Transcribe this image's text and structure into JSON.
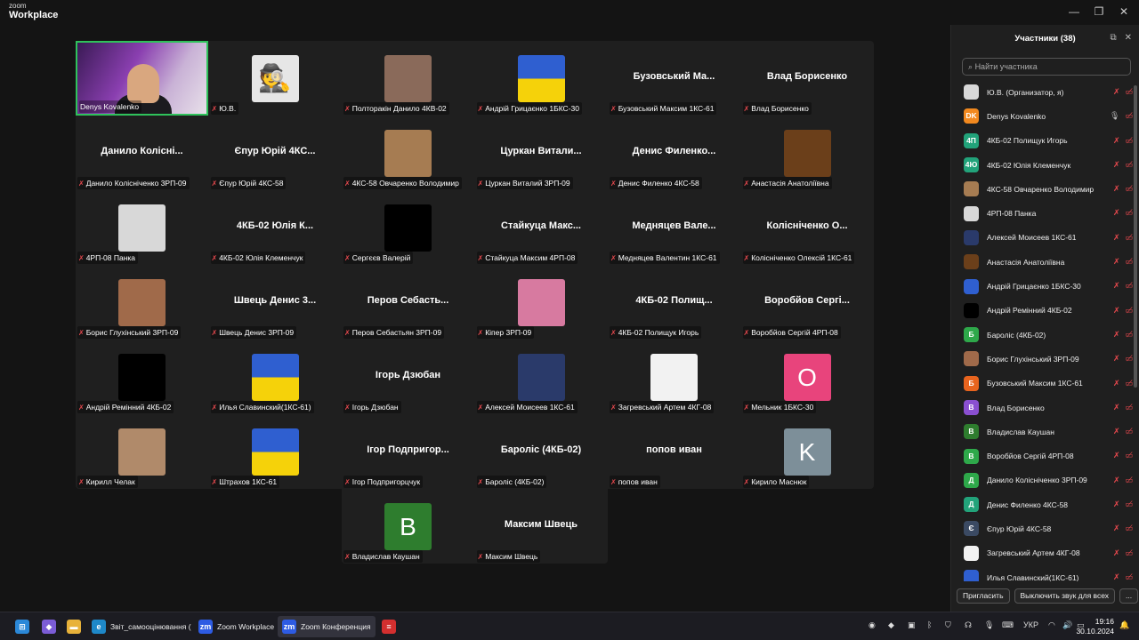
{
  "app": {
    "logo_line1": "zoom",
    "logo_line2": "Workplace"
  },
  "tiles": [
    {
      "caption": "Denys Kovalenko",
      "big": "",
      "avatar": "video",
      "active": true,
      "muted": false
    },
    {
      "caption": "Ю.В.",
      "big": "",
      "avatar": "spy",
      "color": "#e6e6e6"
    },
    {
      "caption": "Полторакін Данило 4КВ-02",
      "big": "",
      "avatar": "photo",
      "color": "#8a6a5a"
    },
    {
      "caption": "Андрій Грицаєнко 1БКС-30",
      "big": "",
      "avatar": "flag",
      "color": "#2f5fd0"
    },
    {
      "caption": "Бузовський Максим 1КС-61",
      "big": "Бузовський Ма...",
      "avatar": ""
    },
    {
      "caption": "Влад Борисенко",
      "big": "Влад Борисенко",
      "avatar": ""
    },
    {
      "caption": "Данило Колісніченко 3РП-09",
      "big": "Данило Колісні...",
      "avatar": ""
    },
    {
      "caption": "Єпур Юрій 4КС-58",
      "big": "Єпур Юрій 4КС...",
      "avatar": ""
    },
    {
      "caption": "4КС-58 Овчаренко Володимир",
      "big": "",
      "avatar": "photo",
      "color": "#a67c52"
    },
    {
      "caption": "Цуркан Виталий 3РП-09",
      "big": "Цуркан Витали...",
      "avatar": ""
    },
    {
      "caption": "Денис Филенко 4КС-58",
      "big": "Денис Филенко...",
      "avatar": ""
    },
    {
      "caption": "Анастасія Анатоліївна",
      "big": "",
      "avatar": "photo",
      "color": "#6b3f1a"
    },
    {
      "caption": "4РП-08 Панка",
      "big": "",
      "avatar": "photo",
      "color": "#d8d8d8"
    },
    {
      "caption": "4КБ-02 Юлія Клеменчук",
      "big": "4КБ-02 Юлія К...",
      "avatar": ""
    },
    {
      "caption": "Сергєєв Валерій",
      "big": "",
      "avatar": "black",
      "color": "#000000"
    },
    {
      "caption": "Стайкуца Максим 4РП-08",
      "big": "Стайкуца Макс...",
      "avatar": ""
    },
    {
      "caption": "Медняцев Валентин 1КС-61",
      "big": "Медняцев Вале...",
      "avatar": ""
    },
    {
      "caption": "Колісніченко Олексій 1КС-61",
      "big": "Колісніченко О...",
      "avatar": ""
    },
    {
      "caption": "Борис Глухінський 3РП-09",
      "big": "",
      "avatar": "photo",
      "color": "#a06a4a"
    },
    {
      "caption": "Швець Денис 3РП-09",
      "big": "Швець Денис 3...",
      "avatar": ""
    },
    {
      "caption": "Перов Себастьян 3РП-09",
      "big": "Перов Себасть...",
      "avatar": ""
    },
    {
      "caption": "Кіпер 3РП-09",
      "big": "",
      "avatar": "photo",
      "color": "#d77aa0"
    },
    {
      "caption": "4КБ-02 Полищук Игорь",
      "big": "4КБ-02 Полищ...",
      "avatar": ""
    },
    {
      "caption": "Воробйов Сергій 4РП-08",
      "big": "Воробйов Сергі...",
      "avatar": ""
    },
    {
      "caption": "Андрій Ремінний 4КБ-02",
      "big": "",
      "avatar": "black",
      "color": "#000000"
    },
    {
      "caption": "Илья Славинский(1КС-61)",
      "big": "",
      "avatar": "flag",
      "color": "#2f5fd0"
    },
    {
      "caption": "Ігорь Дзюбан",
      "big": "Ігорь Дзюбан",
      "avatar": ""
    },
    {
      "caption": "Алексей Моисеев 1КС-61",
      "big": "",
      "avatar": "photo",
      "color": "#2a3a6a"
    },
    {
      "caption": "Загревський Артем 4КГ-08",
      "big": "",
      "avatar": "photo",
      "color": "#f2f2f2"
    },
    {
      "caption": "Мельник 1БКС-30",
      "big": "",
      "avatar": "letter",
      "letter": "О",
      "color": "#e8447c"
    },
    {
      "caption": "Кирилл Челак",
      "big": "",
      "avatar": "photo",
      "color": "#b08a6a"
    },
    {
      "caption": "Штрахов 1КС-61",
      "big": "",
      "avatar": "flag",
      "color": "#2f5fd0"
    },
    {
      "caption": "Ігор Подпригорцчук",
      "big": "Ігор Подпригор...",
      "avatar": ""
    },
    {
      "caption": "Бароліс (4КБ-02)",
      "big": "Бароліс (4КБ-02)",
      "avatar": ""
    },
    {
      "caption": "попов иван",
      "big": "попов иван",
      "avatar": ""
    },
    {
      "caption": "Кирило Маснюк",
      "big": "",
      "avatar": "letter",
      "letter": "K",
      "color": "#7d8f99"
    }
  ],
  "tiles_extra": [
    {
      "caption": "Владислав Каушан",
      "big": "",
      "avatar": "letter",
      "letter": "В",
      "color": "#2e7d2e"
    },
    {
      "caption": "Максим Швець",
      "big": "Максим Швець",
      "avatar": ""
    }
  ],
  "panel": {
    "title": "Участники (38)",
    "search_placeholder": "Найти участника",
    "invite": "Пригласить",
    "mute_all": "Выключить звук для всех",
    "more": "...",
    "participants": [
      {
        "name": "Ю.В. (Организатор, я)",
        "av": "",
        "color": "#d8d8d8"
      },
      {
        "name": "Denys Kovalenko",
        "av": "DK",
        "color": "#f2891f",
        "mic_on": true
      },
      {
        "name": "4КБ-02 Полищук Игорь",
        "av": "4П",
        "color": "#22a37a"
      },
      {
        "name": "4КБ-02 Юлія Клеменчук",
        "av": "4Ю",
        "color": "#22a37a"
      },
      {
        "name": "4КС-58 Овчаренко Володимир",
        "av": "",
        "color": "#a67c52"
      },
      {
        "name": "4РП-08 Панка",
        "av": "",
        "color": "#d8d8d8"
      },
      {
        "name": "Алексей Моисеев 1КС-61",
        "av": "",
        "color": "#2a3a6a"
      },
      {
        "name": "Анастасія Анатоліївна",
        "av": "",
        "color": "#6b3f1a"
      },
      {
        "name": "Андрій Грицаєнко 1БКС-30",
        "av": "",
        "color": "#2f5fd0"
      },
      {
        "name": "Андрій Ремінний 4КБ-02",
        "av": "",
        "color": "#000000"
      },
      {
        "name": "Бароліс (4КБ-02)",
        "av": "Б",
        "color": "#2ea84a"
      },
      {
        "name": "Борис Глухінський 3РП-09",
        "av": "",
        "color": "#a06a4a"
      },
      {
        "name": "Бузовський Максим 1КС-61",
        "av": "Б",
        "color": "#e8641e"
      },
      {
        "name": "Влад Борисенко",
        "av": "В",
        "color": "#8a4fd0"
      },
      {
        "name": "Владислав Каушан",
        "av": "В",
        "color": "#2e7d2e"
      },
      {
        "name": "Воробйов Сергій 4РП-08",
        "av": "В",
        "color": "#2ea84a"
      },
      {
        "name": "Данило Колісніченко 3РП-09",
        "av": "Д",
        "color": "#2ea84a"
      },
      {
        "name": "Денис Филенко 4КС-58",
        "av": "Д",
        "color": "#22a37a"
      },
      {
        "name": "Єпур Юрій 4КС-58",
        "av": "Є",
        "color": "#3b4a63"
      },
      {
        "name": "Загревський Артем 4КГ-08",
        "av": "",
        "color": "#f2f2f2"
      },
      {
        "name": "Илья Славинский(1КС-61)",
        "av": "",
        "color": "#2f5fd0"
      }
    ]
  },
  "taskbar": {
    "items": [
      {
        "label": "",
        "icon": "windows-icon",
        "color": "#2b88d8",
        "glyph": "⊞"
      },
      {
        "label": "",
        "icon": "copilot-icon",
        "color": "#7b5cd6",
        "glyph": "◆"
      },
      {
        "label": "",
        "icon": "folder-icon",
        "color": "#e8b23a",
        "glyph": "▬"
      },
      {
        "label": "Звіт_самооцінювання (",
        "icon": "edge-icon",
        "color": "#1e88c8",
        "glyph": "e"
      },
      {
        "label": "Zoom Workplace",
        "icon": "zoom-icon",
        "color": "#2d5be3",
        "glyph": "zm"
      },
      {
        "label": "Zoom Конференция",
        "icon": "zoom-icon",
        "color": "#2d5be3",
        "glyph": "zm"
      },
      {
        "label": "",
        "icon": "app-icon",
        "color": "#d32f2f",
        "glyph": "≡"
      }
    ],
    "lang": "УКР",
    "time": "19:16",
    "date": "30.10.2024"
  }
}
